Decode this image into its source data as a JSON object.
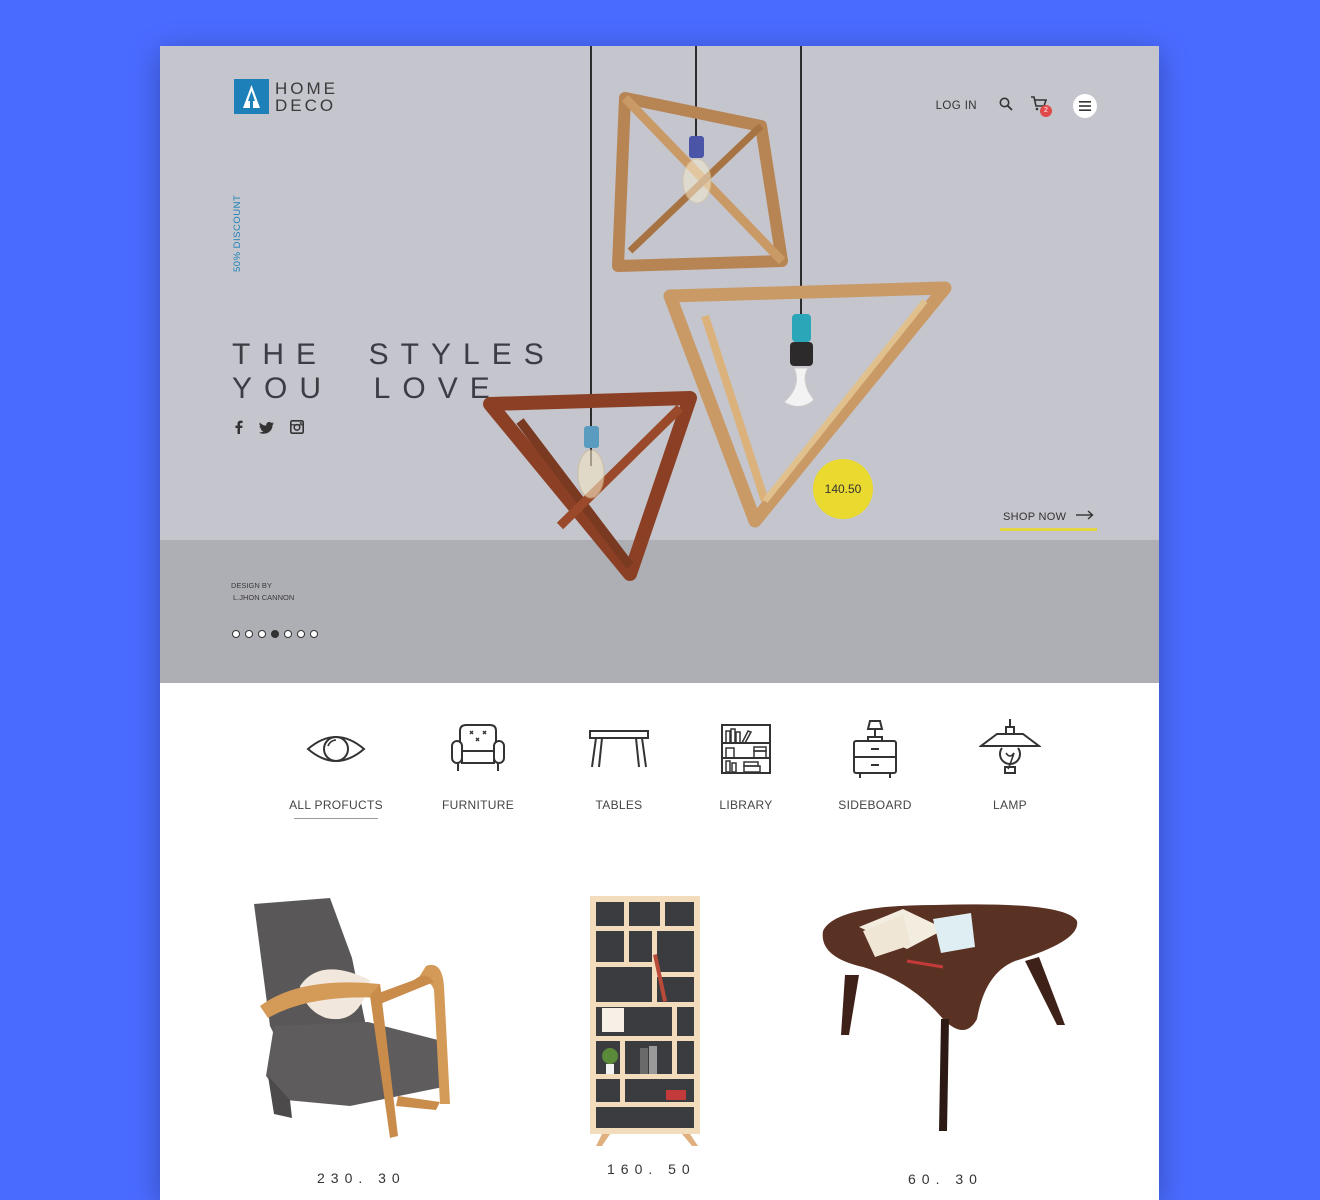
{
  "brand": {
    "line1": "HOME",
    "line2": "DECO"
  },
  "nav": {
    "login": "LOG IN",
    "cart_count": "2"
  },
  "hero": {
    "discount": "50% DISCOUNT",
    "headline": "THE  STYLES\nYOU  LOVE",
    "price": "140.50",
    "shop_now": "SHOP NOW",
    "design_by_label": "DESIGN BY",
    "designer": "L.JHON CANNON",
    "slides_total": 7,
    "slide_active": 4
  },
  "social": [
    "facebook-icon",
    "twitter-icon",
    "instagram-icon"
  ],
  "categories": [
    {
      "label": "ALL PROFUCTS",
      "icon": "eye-icon",
      "active": true
    },
    {
      "label": "FURNITURE",
      "icon": "armchair-icon",
      "active": false
    },
    {
      "label": "TABLES",
      "icon": "table-icon",
      "active": false
    },
    {
      "label": "LIBRARY",
      "icon": "bookshelf-icon",
      "active": false
    },
    {
      "label": "SIDEBOARD",
      "icon": "sideboard-icon",
      "active": false
    },
    {
      "label": "LAMP",
      "icon": "lamp-icon",
      "active": false
    }
  ],
  "products": [
    {
      "price": "230. 30",
      "image": "armchair"
    },
    {
      "price": "160. 50",
      "image": "bookshelf"
    },
    {
      "price": "60. 30",
      "image": "coffee-table"
    }
  ],
  "colors": {
    "background": "#4a6bff",
    "accent": "#1d80b8",
    "hero": "#c5c5cd",
    "highlight": "#ead92e"
  }
}
